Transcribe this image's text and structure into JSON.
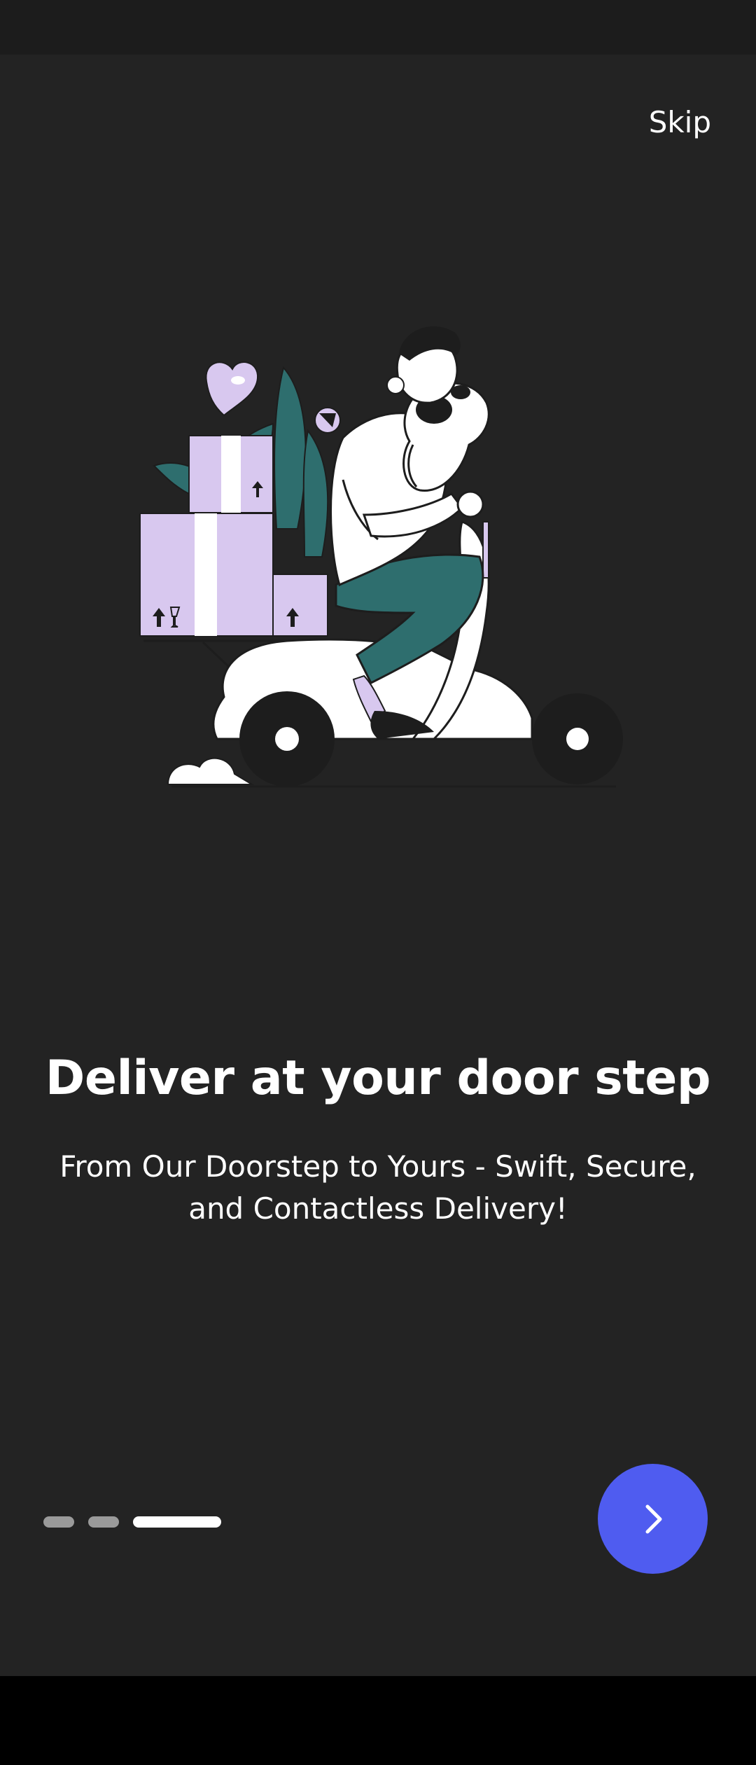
{
  "onboarding": {
    "skip_label": "Skip",
    "title": "Deliver at your door step",
    "subtitle": "From Our Doorstep to Yours - Swift, Secure, and Contactless Delivery!",
    "page_indicator": {
      "total": 3,
      "current": 3
    },
    "next_icon": "chevron-right-icon",
    "illustration": "delivery-person-on-scooter-with-dog-and-boxes"
  },
  "colors": {
    "background": "#232323",
    "status_bar": "#1c1c1c",
    "nav_bar": "#000000",
    "accent_button": "#4f5cf0",
    "box_lavender": "#d8c8ef",
    "plant_teal": "#2e6e6e",
    "dot_inactive": "#9a9a9a",
    "dot_active": "#ffffff"
  }
}
